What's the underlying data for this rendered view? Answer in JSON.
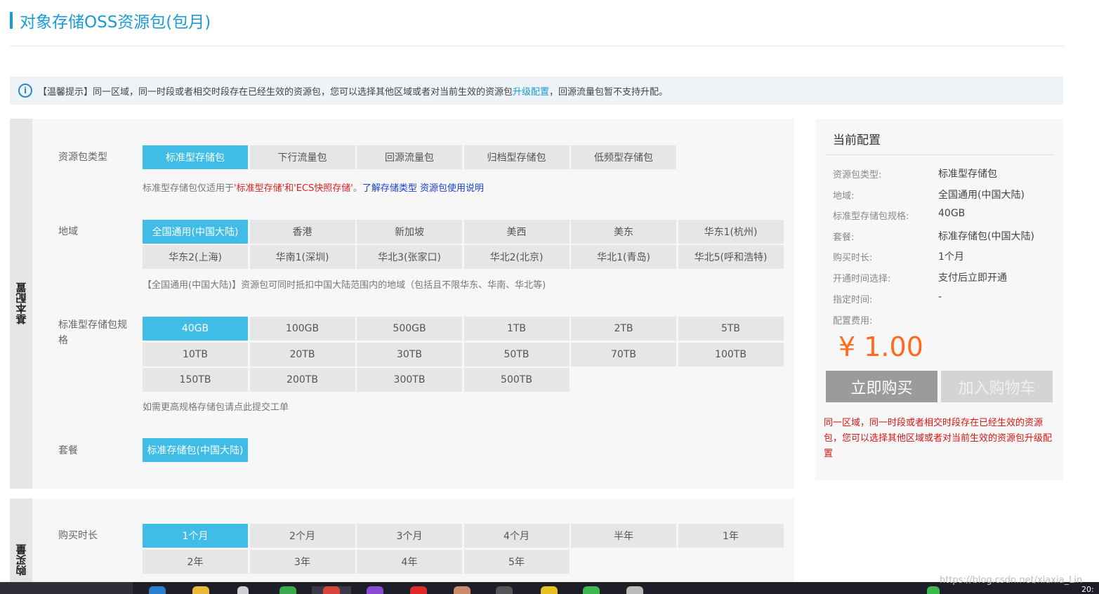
{
  "page": {
    "title": "对象存储OSS资源包(包月)"
  },
  "notice": {
    "before": "【温馨提示】同一区域，同一时段或者相交时段存在已经生效的资源包，您可以选择其他区域或者对当前生效的资源包",
    "link": "升级配置",
    "after": "，回源流量包暂不支持升配。"
  },
  "basic": {
    "side_label": "基本配置",
    "type": {
      "label": "资源包类型",
      "options": [
        "标准型存储包",
        "下行流量包",
        "回源流量包",
        "归档型存储包",
        "低频型存储包"
      ],
      "selected": "标准型存储包",
      "hint_prefix": "标准型存储包仅适用于",
      "hint_red": "'标准型存储'和'ECS快照存储'",
      "hint_mid": "。",
      "hint_link1": "了解存储类型",
      "hint_link2": "资源包使用说明"
    },
    "region": {
      "label": "地域",
      "options": [
        "全国通用(中国大陆)",
        "香港",
        "新加坡",
        "美西",
        "美东",
        "华东1(杭州)",
        "华东2(上海)",
        "华南1(深圳)",
        "华北3(张家口)",
        "华北2(北京)",
        "华北1(青岛)",
        "华北5(呼和浩特)"
      ],
      "selected": "全国通用(中国大陆)",
      "hint": "【全国通用(中国大陆)】资源包可同时抵扣中国大陆范围内的地域（包括且不限华东、华南、华北等)"
    },
    "spec": {
      "label": "标准型存储包规格",
      "options": [
        "40GB",
        "100GB",
        "500GB",
        "1TB",
        "2TB",
        "5TB",
        "10TB",
        "20TB",
        "30TB",
        "50TB",
        "70TB",
        "100TB",
        "150TB",
        "200TB",
        "300TB",
        "500TB"
      ],
      "selected": "40GB",
      "hint": "如需更高规格存储包请点此提交工单"
    },
    "plan": {
      "label": "套餐",
      "options": [
        "标准存储包(中国大陆)"
      ],
      "selected": "标准存储包(中国大陆)"
    }
  },
  "buy": {
    "side_label": "购买量",
    "duration": {
      "label": "购买时长",
      "options": [
        "1个月",
        "2个月",
        "3个月",
        "4个月",
        "半年",
        "1年",
        "2年",
        "3年",
        "4年",
        "5年"
      ],
      "selected": "1个月"
    }
  },
  "summary": {
    "title": "当前配置",
    "rows": [
      {
        "key": "资源包类型:",
        "value": "标准型存储包"
      },
      {
        "key": "地域:",
        "value": "全国通用(中国大陆)"
      },
      {
        "key": "标准型存储包规格:",
        "value": "40GB"
      },
      {
        "key": "套餐:",
        "value": "标准存储包(中国大陆)"
      },
      {
        "key": "购买时长:",
        "value": "1个月"
      },
      {
        "key": "开通时间选择:",
        "value": "支付后立即开通"
      },
      {
        "key": "指定时间:",
        "value": "-"
      }
    ],
    "fee_label": "配置费用:",
    "price": "¥ 1.00",
    "buy_button": "立即购买",
    "cart_button": "加入购物车",
    "warning": "同一区域，同一时段或者相交时段存在已经生效的资源包，您可以选择其他区域或者对当前生效的资源包升级配置"
  },
  "watermark": "https://blog.csdn.net/xiaxia_Lin",
  "clock": "20:",
  "colors": {
    "accent": "#3fbde6",
    "title": "#1b9ad6",
    "price": "#ff6a1f",
    "warning": "#d91515"
  }
}
